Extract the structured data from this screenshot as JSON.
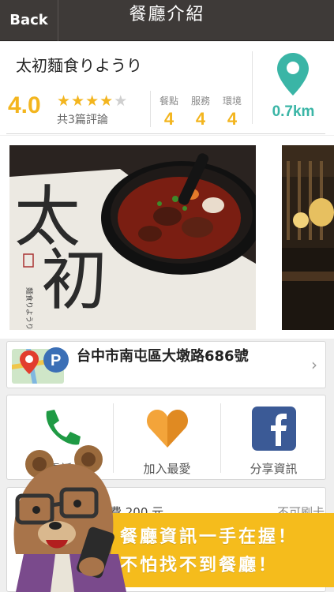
{
  "navbar": {
    "back_label": "Back",
    "title": "餐廳介紹"
  },
  "restaurant": {
    "name": "太初麵食りようり",
    "score": "4.0",
    "stars": 4,
    "max_stars": 5,
    "review_count": "共3篇評論",
    "subratings": [
      {
        "label": "餐點",
        "value": "4"
      },
      {
        "label": "服務",
        "value": "4"
      },
      {
        "label": "環境",
        "value": "4"
      }
    ],
    "distance": "0.7km"
  },
  "photo": {
    "calligraphy_1": "太",
    "calligraphy_2": "初",
    "caption_small": "麵食りようり"
  },
  "address": {
    "text": "台中市南屯區大墩路686號"
  },
  "actions": [
    {
      "label": "電話",
      "icon": "phone-icon"
    },
    {
      "label": "加入最愛",
      "icon": "heart-icon"
    },
    {
      "label": "分享資訊",
      "icon": "facebook-icon"
    }
  ],
  "info": {
    "partial_left": "低消費 200 元",
    "partial_right": "不可刷卡"
  },
  "promo": {
    "line1": "餐廳資訊一手在握！",
    "line2": "不怕找不到餐廳！"
  },
  "colors": {
    "accent": "#f3b51e",
    "teal": "#3ab5a6",
    "navbar": "#3e3a38",
    "promo": "#f5bc1c"
  }
}
